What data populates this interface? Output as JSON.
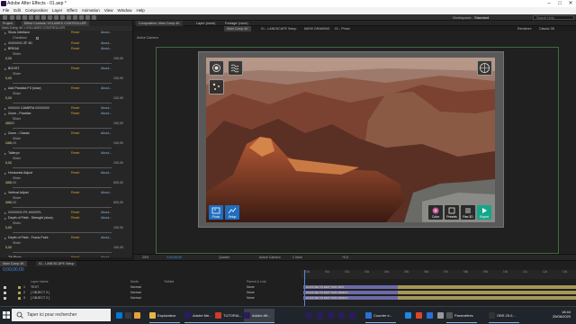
{
  "window": {
    "title": "Adobe After Effects - 01.aep *"
  },
  "menu": [
    "File",
    "Edit",
    "Composition",
    "Layer",
    "Effect",
    "Animation",
    "View",
    "Window",
    "Help"
  ],
  "toolbar": {
    "workspace_label": "Workspace:",
    "workspace_value": "Standard",
    "search_placeholder": "Search Help"
  },
  "effect_panel": {
    "tabs": [
      "Project",
      "Effect Controls: VOLUMES CONTROLLER"
    ],
    "breadcrumb": "Main Comp 4K • VOLUMES CONTROLLER",
    "rows": [
      {
        "kind": "effect",
        "name": "Show Interface",
        "reset": "Reset",
        "about": "About..."
      },
      {
        "kind": "prop",
        "label": "Checkbox",
        "value": ""
      },
      {
        "kind": "effect",
        "name": "/////////////\\\\\\ ZF 3D",
        "reset": "Reset",
        "about": "About..."
      },
      {
        "kind": "effect",
        "name": "BREAK",
        "reset": "Reset",
        "about": "About..."
      },
      {
        "kind": "prop",
        "label": "Slider",
        "value": "0,00"
      },
      {
        "kind": "slider",
        "min": "0,00",
        "max": "100,00"
      },
      {
        "kind": "effect",
        "name": "BOOST",
        "reset": "Reset",
        "about": "About..."
      },
      {
        "kind": "prop",
        "label": "Slider",
        "value": "0,00"
      },
      {
        "kind": "slider",
        "min": "0,00",
        "max": "100,00"
      },
      {
        "kind": "effect",
        "name": "Add Parallax FX (slow)",
        "reset": "Reset",
        "about": "About..."
      },
      {
        "kind": "prop",
        "label": "Slider",
        "value": "0,00"
      },
      {
        "kind": "slider",
        "min": "0,00",
        "max": "100,00"
      },
      {
        "kind": "effect",
        "name": "////////\\\\\\\\\\ CAMERA ///////////\\\\\\\\\\",
        "reset": "Reset",
        "about": "About..."
      },
      {
        "kind": "effect",
        "name": "Zoom - Parallax",
        "reset": "Reset",
        "about": "About..."
      },
      {
        "kind": "prop",
        "label": "Slider",
        "value": "0,00"
      },
      {
        "kind": "slider",
        "min": "-85,00",
        "max": "100,00"
      },
      {
        "kind": "effect",
        "name": "Zoom - Classic",
        "reset": "Reset",
        "about": "About..."
      },
      {
        "kind": "prop",
        "label": "Slider",
        "value": "0,00"
      },
      {
        "kind": "slider",
        "min": "-100,00",
        "max": "100,00"
      },
      {
        "kind": "effect",
        "name": "Tallerpo",
        "reset": "Reset",
        "about": "About..."
      },
      {
        "kind": "prop",
        "label": "Slider",
        "value": "0,00"
      },
      {
        "kind": "slider",
        "min": "0,00",
        "max": "100,00"
      },
      {
        "kind": "effect",
        "name": "Horizontal Adjust",
        "reset": "Reset",
        "about": "About..."
      },
      {
        "kind": "prop",
        "label": "Slider",
        "value": "0,00"
      },
      {
        "kind": "slider",
        "min": "-600,00",
        "max": "600,00"
      },
      {
        "kind": "effect",
        "name": "Vertical Adjust",
        "reset": "Reset",
        "about": "About..."
      },
      {
        "kind": "prop",
        "label": "Slider",
        "value": "0,00"
      },
      {
        "kind": "slider",
        "min": "-600,00",
        "max": "600,00"
      },
      {
        "kind": "effect",
        "name": "/////////////\\\\\\ FX ///////////\\\\\\",
        "reset": "Reset",
        "about": "About..."
      },
      {
        "kind": "effect",
        "name": "Depth of Field - Strenght (slow)",
        "reset": "Reset",
        "about": "About..."
      },
      {
        "kind": "prop",
        "label": "Slider",
        "value": "0,00"
      },
      {
        "kind": "slider",
        "min": "0,00",
        "max": "100,00"
      },
      {
        "kind": "effect",
        "name": "Depth of Field - Focus Point",
        "reset": "Reset",
        "about": "About..."
      },
      {
        "kind": "prop",
        "label": "Slider",
        "value": "0,00"
      },
      {
        "kind": "slider",
        "min": "0,00",
        "max": "100,00"
      },
      {
        "kind": "effect",
        "name": "Tilt Photo",
        "reset": "Reset",
        "about": "About..."
      },
      {
        "kind": "prop",
        "label": "Checkbox",
        "value": ""
      }
    ]
  },
  "composition": {
    "tabs": [
      "Composition: Main Comp 4K",
      "Layer: (none)",
      "Footage: (none)"
    ],
    "crumbs": [
      "Main Comp 4K",
      "01 - LANDSCAPE Setup",
      "MASK DRAWING",
      "01 - Photo"
    ],
    "renderer_label": "Renderer:",
    "renderer_value": "Classic 3D",
    "active_camera": "Active Camera",
    "buttons": {
      "photo": "Photo",
      "setup": "Setup",
      "color": "Color",
      "presets": "Presets",
      "parallax": "Parr.3D",
      "preview": "Preview",
      "export": "Export"
    }
  },
  "viewer_bar": {
    "zoom": "25%",
    "timecode": "0;00;00;00",
    "resolution": "Quarter",
    "camera": "Active Camera",
    "views": "1 View",
    "exposure": "+0,0"
  },
  "timeline": {
    "tabs": [
      "Main Comp 4K",
      "01 - LANDSCAPE Setup"
    ],
    "timecode": "0;00;00;00",
    "columns": {
      "layer": "Layer Name",
      "mode": "Mode",
      "trkmat": "TrkMat",
      "parent": "Parent & Link"
    },
    "ruler": [
      "00s",
      "01s",
      "02s",
      "03s",
      "04s",
      "05s",
      "06s",
      "07s",
      "08s",
      "09s",
      "10s",
      "11s",
      "12s",
      "13s"
    ],
    "layers": [
      {
        "num": "1",
        "name": "TEXT",
        "mode": "Normal",
        "parent": "None",
        "color": "#b8a14a"
      },
      {
        "num": "2",
        "name": "[ OBJECT 3 ]",
        "mode": "Normal",
        "parent": "None",
        "color": "#b8a14a"
      },
      {
        "num": "3",
        "name": "[ OBJECT 2 ]",
        "mode": "Normal",
        "parent": "None",
        "color": "#b8a14a"
      }
    ],
    "track_labels": [
      "CLICK ME TO EDIT THIS TEXT",
      "CLICK ME TO EDIT THIS OBJECT",
      "CLICK ME TO EDIT THIS OBJECT"
    ]
  },
  "taskbar": {
    "search_placeholder": "Taper ici pour rechercher",
    "apps": [
      {
        "name": "Explorateur",
        "color": "#e8b540"
      },
      {
        "name": "Adobe Me...",
        "color": "#2b1b5e"
      },
      {
        "name": "TUTORIA...",
        "color": "#d03a2b"
      },
      {
        "name": "Adobe Aft...",
        "color": "#2b1b5e"
      },
      {
        "name": "Courrier e...",
        "color": "#2a6fd6"
      },
      {
        "name": "Paramètres",
        "color": "#555"
      },
      {
        "name": "OBS 25.0...",
        "color": "#333"
      }
    ],
    "time": "18:44",
    "date": "25/06/2020"
  }
}
